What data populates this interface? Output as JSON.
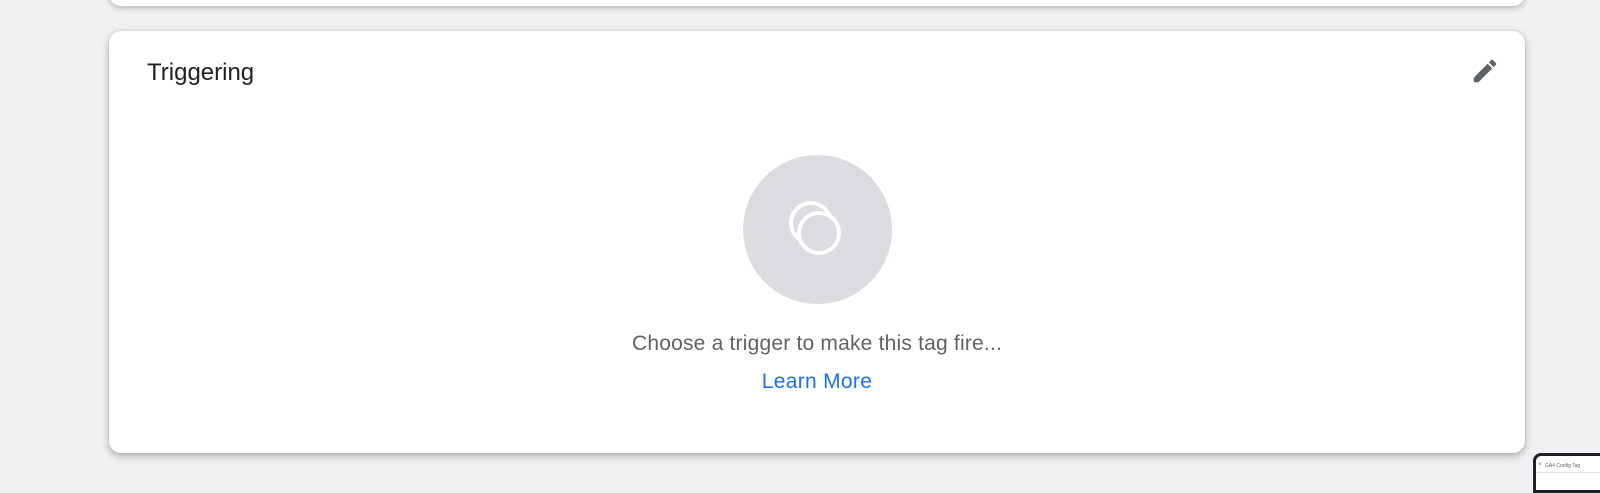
{
  "triggering_card": {
    "title": "Triggering",
    "edit_icon": "pencil-edit-icon",
    "trigger_icon": "overlapping-circles-trigger-icon",
    "empty_message": "Choose a trigger to make this tag fire...",
    "learn_more_label": "Learn More"
  },
  "thumbnail": {
    "close_glyph": "×",
    "title": "GA4 Config Tag"
  },
  "colors": {
    "background": "#eef0f2",
    "card": "#ffffff",
    "icon_circle": "#dadce0",
    "link": "#1a73e8",
    "muted_text": "#5f6368"
  }
}
